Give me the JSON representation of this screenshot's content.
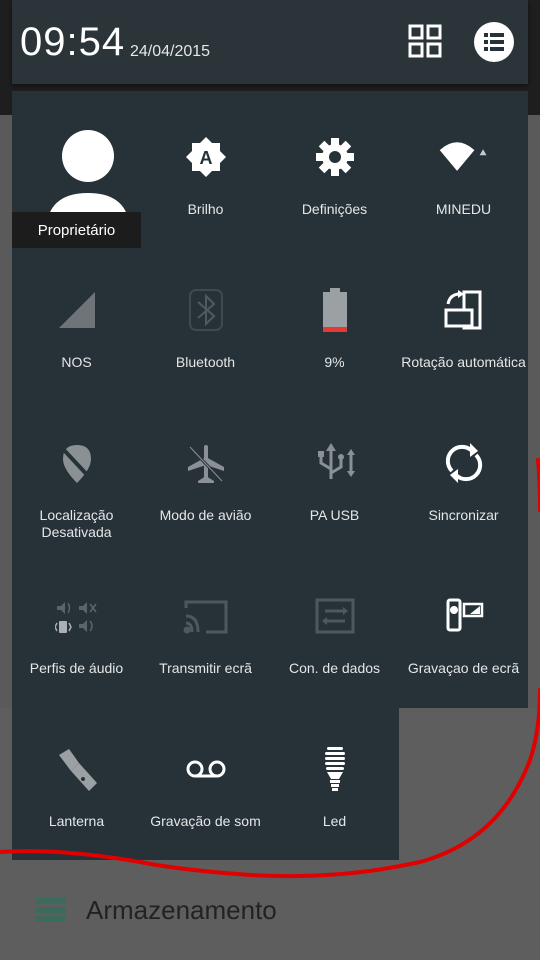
{
  "status": {
    "time": "09:54",
    "date": "24/04/2015"
  },
  "header_icons": {
    "grid": "grid-view-icon",
    "list": "list-icon"
  },
  "owner": {
    "label": "Proprietário"
  },
  "tiles": [
    {
      "label": "Brilho",
      "icon": "brightness-auto-icon"
    },
    {
      "label": "Definições",
      "icon": "settings-gear-icon"
    },
    {
      "label": "MINEDU",
      "icon": "wifi-icon"
    },
    {
      "label": "NOS",
      "icon": "cell-signal-icon"
    },
    {
      "label": "Bluetooth",
      "icon": "bluetooth-icon"
    },
    {
      "label": "9%",
      "icon": "battery-icon"
    },
    {
      "label": "Rotação automática",
      "icon": "rotation-icon"
    },
    {
      "label": "Localização Desativada",
      "icon": "location-off-icon"
    },
    {
      "label": "Modo de avião",
      "icon": "airplane-icon"
    },
    {
      "label": "PA USB",
      "icon": "usb-icon"
    },
    {
      "label": "Sincronizar",
      "icon": "sync-icon"
    },
    {
      "label": "Perfis de áudio",
      "icon": "audio-profiles-icon"
    },
    {
      "label": "Transmitir ecrã",
      "icon": "cast-icon"
    },
    {
      "label": "Con. de dados",
      "icon": "data-connection-icon"
    },
    {
      "label": "Gravaçao de ecrã",
      "icon": "screen-record-icon"
    },
    {
      "label": "Lanterna",
      "icon": "flashlight-icon"
    },
    {
      "label": "Gravação de som",
      "icon": "voicemail-icon"
    },
    {
      "label": "Led",
      "icon": "led-bulb-icon"
    }
  ],
  "background": {
    "storage_label": "Armazenamento"
  },
  "colors": {
    "panel": "#263238",
    "header": "#2a3439",
    "battery_low": "#e53935",
    "annotation": "#e00000"
  }
}
